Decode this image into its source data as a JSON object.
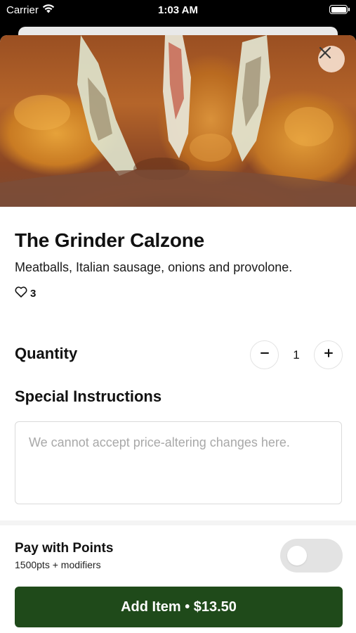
{
  "status_bar": {
    "carrier": "Carrier",
    "time": "1:03 AM"
  },
  "item": {
    "name": "The Grinder Calzone",
    "description": "Meatballs, Italian sausage, onions and provolone.",
    "likes": "3"
  },
  "quantity": {
    "label": "Quantity",
    "value": "1",
    "decrement_icon": "minus-icon",
    "increment_icon": "plus-icon"
  },
  "instructions": {
    "label": "Special Instructions",
    "placeholder": "We cannot accept price-altering changes here.",
    "value": ""
  },
  "points": {
    "title": "Pay with Points",
    "subtitle": "1500pts + modifiers",
    "enabled": false
  },
  "add_button": {
    "label": "Add Item • $13.50"
  },
  "colors": {
    "primary_button": "#1f4a1a",
    "toggle_off": "#e3e3e3",
    "close_button_bg": "#f5decd"
  }
}
